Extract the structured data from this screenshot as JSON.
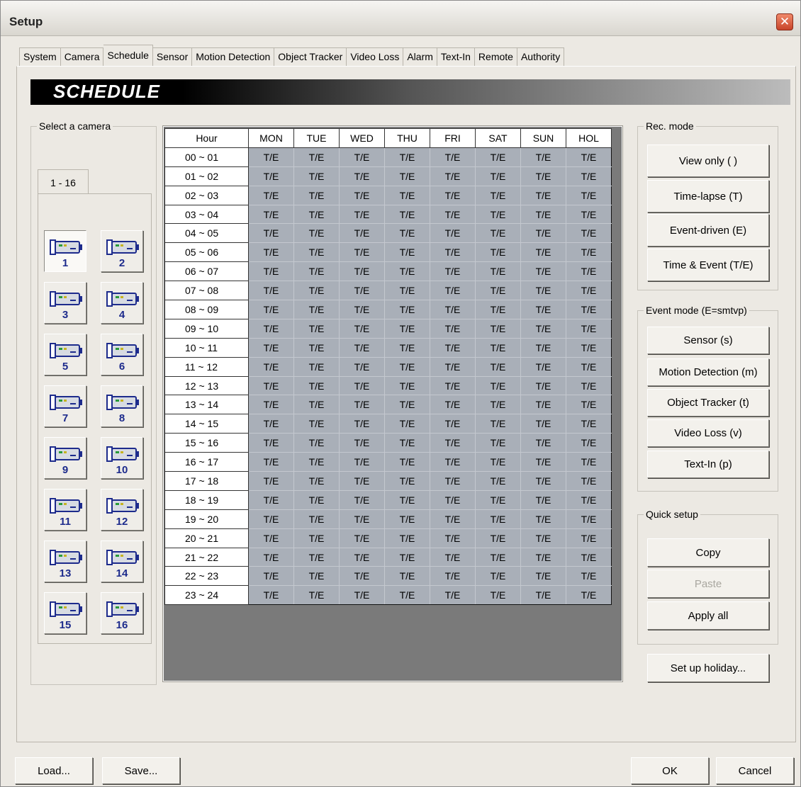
{
  "window": {
    "title": "Setup",
    "close_label": "✕"
  },
  "tabs": [
    "System",
    "Camera",
    "Schedule",
    "Sensor",
    "Motion Detection",
    "Object Tracker",
    "Video Loss",
    "Alarm",
    "Text-In",
    "Remote",
    "Authority"
  ],
  "active_tab": "Schedule",
  "banner": "SCHEDULE",
  "camera_panel": {
    "legend": "Select a camera",
    "tab_label": "1 - 16",
    "cameras": [
      "1",
      "2",
      "3",
      "4",
      "5",
      "6",
      "7",
      "8",
      "9",
      "10",
      "11",
      "12",
      "13",
      "14",
      "15",
      "16"
    ],
    "selected": "1"
  },
  "schedule": {
    "hour_header": "Hour",
    "days": [
      "MON",
      "TUE",
      "WED",
      "THU",
      "FRI",
      "SAT",
      "SUN",
      "HOL"
    ],
    "hours": [
      "00 ~ 01",
      "01 ~ 02",
      "02 ~ 03",
      "03 ~ 04",
      "04 ~ 05",
      "05 ~ 06",
      "06 ~ 07",
      "07 ~ 08",
      "08 ~ 09",
      "09 ~ 10",
      "10 ~ 11",
      "11 ~ 12",
      "12 ~ 13",
      "13 ~ 14",
      "14 ~ 15",
      "15 ~ 16",
      "16 ~ 17",
      "17 ~ 18",
      "18 ~ 19",
      "19 ~ 20",
      "20 ~ 21",
      "21 ~ 22",
      "22 ~ 23",
      "23 ~ 24"
    ],
    "cell_value": "T/E"
  },
  "rec_mode": {
    "legend": "Rec. mode",
    "buttons": [
      "View only ( )",
      "Time-lapse (T)",
      "Event-driven (E)",
      "Time & Event (T/E)"
    ]
  },
  "event_mode": {
    "legend": "Event mode (E=smtvp)",
    "buttons": [
      "Sensor (s)",
      "Motion Detection (m)",
      "Object Tracker (t)",
      "Video Loss (v)",
      "Text-In (p)"
    ]
  },
  "quick_setup": {
    "legend": "Quick setup",
    "copy": "Copy",
    "paste": "Paste",
    "apply_all": "Apply all"
  },
  "holiday_button": "Set up holiday...",
  "footer": {
    "load": "Load...",
    "save": "Save...",
    "ok": "OK",
    "cancel": "Cancel"
  }
}
